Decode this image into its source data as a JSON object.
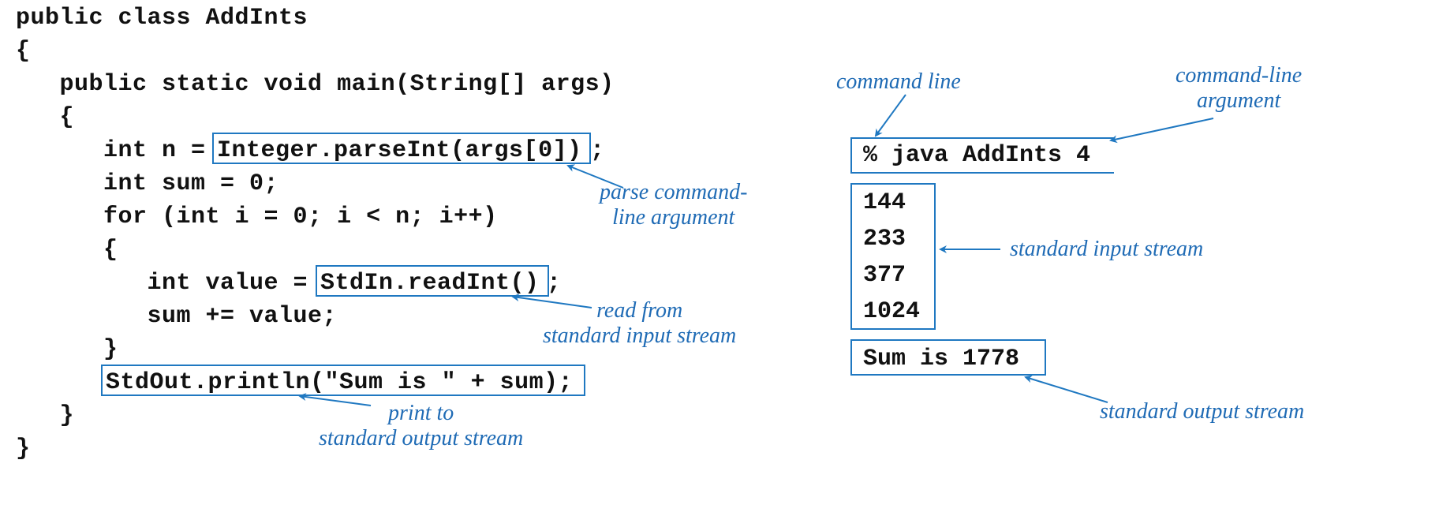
{
  "code": {
    "l1": "public class AddInts",
    "l2": "{",
    "l3": "   public static void main(String[] args)",
    "l4": "   {",
    "l5a": "      int n = ",
    "l5b": "Integer.parseInt(args[0])",
    "l5c": ";",
    "l6": "      int sum = 0;",
    "l7": "      for (int i = 0; i < n; i++)",
    "l8": "      {",
    "l9a": "         int value = ",
    "l9b": "StdIn.readInt()",
    "l9c": ";",
    "l10": "         sum += value;",
    "l11": "      }",
    "l12a": "      ",
    "l12b": "StdOut.println(\"Sum is \" + sum);",
    "l13": "   }",
    "l14": "}"
  },
  "labels": {
    "parse": "parse command-\nline argument",
    "read": "read from\nstandard input stream",
    "print": "print to\nstandard output stream",
    "cmdline": "command line",
    "cmdarg": "command-line\nargument",
    "stdin": "standard input stream",
    "stdout": "standard output stream"
  },
  "terminal": {
    "cmd": "% java AddInts 4",
    "in1": "144",
    "in2": "233",
    "in3": "377",
    "in4": "1024",
    "out": "Sum is 1778"
  },
  "colors": {
    "blue": "#1f78c1"
  }
}
